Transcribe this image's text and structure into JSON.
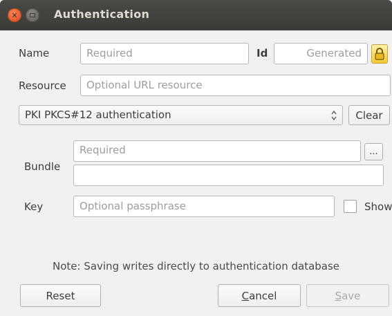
{
  "window": {
    "title": "Authentication"
  },
  "form": {
    "name_label": "Name",
    "name_placeholder": "Required",
    "id_label": "Id",
    "id_placeholder": "Generated",
    "resource_label": "Resource",
    "resource_placeholder": "Optional URL resource",
    "method_selected": "PKI PKCS#12 authentication",
    "clear_label": "Clear",
    "bundle_label": "Bundle",
    "bundle_placeholder": "Required",
    "bundle_secondary_value": "",
    "browse_label": "...",
    "key_label": "Key",
    "key_placeholder": "Optional passphrase",
    "show_label": "Show",
    "show_checked": false
  },
  "note": "Note: Saving writes directly to authentication database",
  "buttons": {
    "reset": "Reset",
    "cancel_prefix": "C",
    "cancel_rest": "ancel",
    "save_prefix": "S",
    "save_rest": "ave"
  },
  "icons": {
    "close": "close-icon",
    "minimize": "minimize-icon",
    "lock": "lock-icon",
    "spin": "up-down-arrows-icon"
  },
  "colors": {
    "titlebar": "#3c3b37",
    "close_button": "#e25a2b",
    "lock_fill": "#f5c932",
    "window_bg": "#f2f1f0"
  }
}
